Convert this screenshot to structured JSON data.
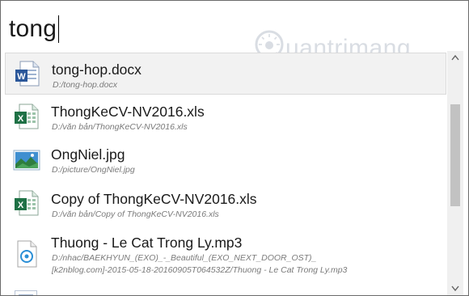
{
  "search": {
    "query": "tong"
  },
  "watermark": {
    "text": "uantrimang"
  },
  "results": [
    {
      "name": "tong-hop.docx",
      "path": "D:/tong-hop.docx",
      "icon": "word-document-icon",
      "selected": true
    },
    {
      "name": "ThongKeCV-NV2016.xls",
      "path": "D:/văn bản/ThongKeCV-NV2016.xls",
      "icon": "excel-spreadsheet-icon",
      "selected": false
    },
    {
      "name": "OngNiel.jpg",
      "path": "D:/picture/OngNiel.jpg",
      "icon": "image-file-icon",
      "selected": false
    },
    {
      "name": "Copy of ThongKeCV-NV2016.xls",
      "path": "D:/văn bản/Copy of ThongKeCV-NV2016.xls",
      "icon": "excel-spreadsheet-icon",
      "selected": false
    },
    {
      "name": "Thuong - Le Cat Trong Ly.mp3",
      "path": "D:/nhac/BAEKHYUN_(EXO)_-_Beautiful_(EXO_NEXT_DOOR_OST)_",
      "path2": "[k2nblog.com]-2015-05-18-20160905T064532Z/Thuong - Le Cat Trong Ly.mp3",
      "icon": "audio-file-icon",
      "selected": false
    }
  ],
  "colors": {
    "selection": "#f2f2f2",
    "excel": "#1e7145",
    "word": "#2b579a",
    "scroll_thumb": "#c2c2c2"
  }
}
